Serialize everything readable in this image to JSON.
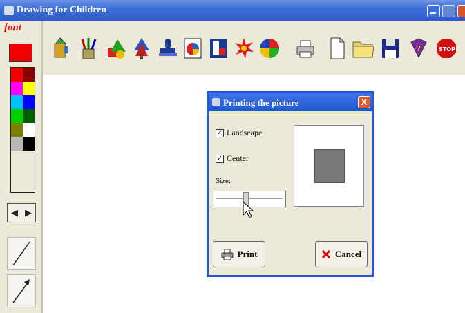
{
  "window": {
    "title": "Drawing for Children"
  },
  "left_panel": {
    "font_label": "font",
    "current_color": "#f00000",
    "palette": [
      "#f00000",
      "#8b0000",
      "#ff00ff",
      "#ffff00",
      "#00c0ff",
      "#0000ff",
      "#00d000",
      "#006000",
      "#808000",
      "#ffffff",
      "#b8b8b8",
      "#000000"
    ],
    "undo_glyph": "◀",
    "redo_glyph": "▶"
  },
  "toolbar": {
    "tools": [
      "paint-bucket",
      "brushes",
      "shapes",
      "tree-stamp",
      "stamp",
      "palette-card",
      "color-frame",
      "fireworks",
      "pinwheel",
      "printer",
      "new-file",
      "open-folder",
      "save-disk",
      "help-book",
      "stop-sign"
    ]
  },
  "dialog": {
    "title": "Printing the picture",
    "close_glyph": "X",
    "landscape_label": "Landscape",
    "landscape_checked": true,
    "center_label": "Center",
    "center_checked": true,
    "size_label": "Size:",
    "size_value": 0.45,
    "print_label": "Print",
    "cancel_label": "Cancel",
    "check_glyph": "✓"
  }
}
